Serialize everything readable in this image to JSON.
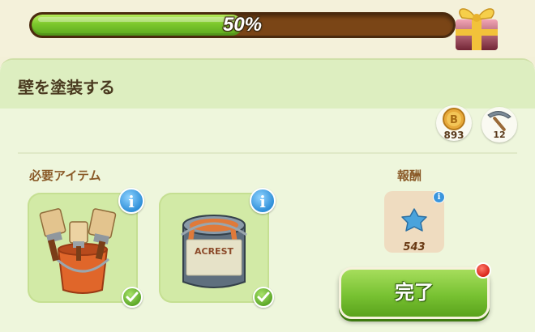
{
  "progress": {
    "label": "50%",
    "fraction": 0.5
  },
  "task": {
    "title": "壁を塗装する"
  },
  "resources": [
    {
      "icon": "coin-icon",
      "value": "893"
    },
    {
      "icon": "pickaxe-icon",
      "value": "12"
    }
  ],
  "required": {
    "label": "必要アイテム",
    "items": [
      {
        "icon": "paintbrush-bucket-icon",
        "complete": true
      },
      {
        "icon": "paint-can-icon",
        "complete": true
      }
    ]
  },
  "reward": {
    "label": "報酬",
    "icon": "blue-star-icon",
    "value": "543"
  },
  "action": {
    "label": "完了"
  },
  "colors": {
    "progress_fill": "#7cc72c",
    "track": "#7a4516",
    "info_blue": "#2f8fd8",
    "done_green": "#78c232",
    "notification_red": "#d8241a"
  }
}
